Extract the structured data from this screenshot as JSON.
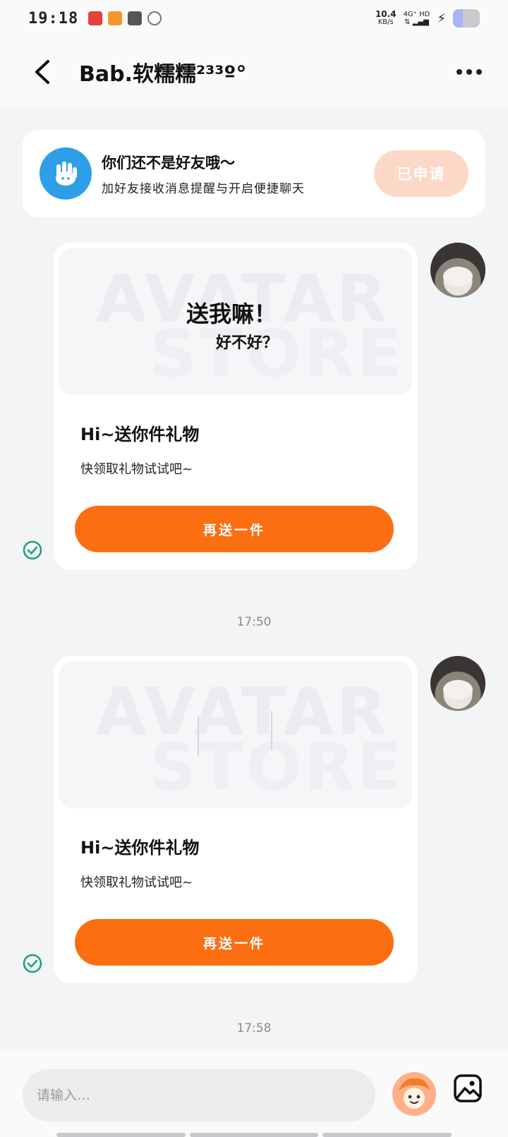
{
  "status_bar": {
    "time": "19:18",
    "net_speed_value": "10.4",
    "net_speed_unit": "KB/s",
    "signal_label": "4G⁺ HD",
    "app_icon_colors": [
      "#e8403b",
      "#f5952f",
      "#555555",
      "#777777"
    ]
  },
  "header": {
    "back_icon": "chevron-left-icon",
    "title": "Bab.软糯糯²³³º°",
    "more_icon": "more-dots-icon"
  },
  "friend_banner": {
    "icon": "hand-wave-icon",
    "title": "你们还不是好友哦～",
    "subtitle": "加好友接收消息提醒与开启便捷聊天",
    "button_label": "已申请",
    "button_color": "#fcd8c6"
  },
  "messages": [
    {
      "image_watermark_line1": "AVATAR",
      "image_watermark_line2": "STORE",
      "image_caption_line1": "送我嘛！",
      "image_caption_line2": "好不好？",
      "title": "Hi~送你件礼物",
      "description": "快领取礼物试试吧~",
      "button_label": "再送一件",
      "status": "sent",
      "timestamp": "17:50"
    },
    {
      "image_watermark_line1": "AVATAR",
      "image_watermark_line2": "STORE",
      "image_caption_line1": "",
      "image_caption_line2": "",
      "title": "Hi~送你件礼物",
      "description": "快领取礼物试试吧~",
      "button_label": "再送一件",
      "status": "sent",
      "timestamp": "17:58"
    }
  ],
  "colors": {
    "accent_orange": "#fb6e12",
    "check_green": "#1aa07a",
    "banner_icon_blue": "#2f9ee8"
  },
  "input_bar": {
    "placeholder": "请输入…",
    "sticker_icon": "sticker-face-icon",
    "image_icon": "image-gallery-icon"
  }
}
